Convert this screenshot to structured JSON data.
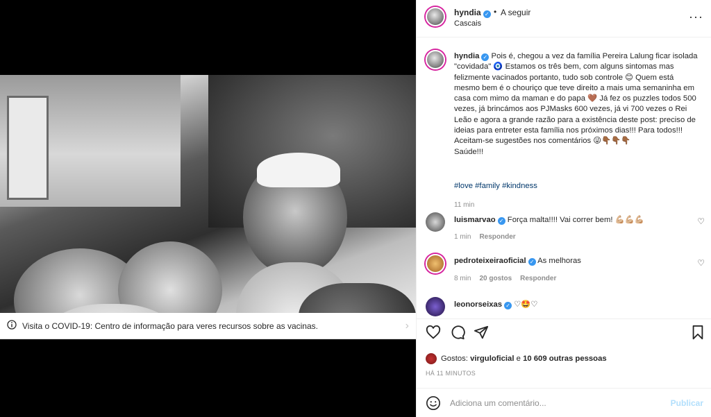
{
  "post": {
    "username": "hyndia",
    "follow_dot": "•",
    "follow_label": "A seguir",
    "location": "Cascais",
    "more_glyph": "···"
  },
  "banner": {
    "text": "Visita o COVID-19: Centro de informação para veres recursos sobre as vacinas."
  },
  "caption": {
    "username": "hyndia",
    "text": "Pois é, chegou a vez da família Pereira Lalung ficar isolada \"covidada\" 🧿 Estamos os três bem, com alguns sintomas mas felizmente vacinados portanto, tudo sob controle 😊 Quem está mesmo bem é o chouriço que teve direito a mais uma semaninha em casa com mimo da maman e do papa 🤎 Já fez os puzzles todos 500 vezes, já brincámos aos PJMasks 600 vezes, já vi 700 vezes o Rei Leão e agora a grande razão para a existência deste post: preciso de ideias para entreter esta família nos próximos dias!!! Para todos!!! Aceitam-se sugestões nos comentários 😜👇🏾👇🏾👇🏾",
    "sign_off": "Saúde!!!",
    "tags": "#love #family #kindness",
    "time": "11 min"
  },
  "comments": [
    {
      "username": "luismarvao",
      "text": "Força malta!!!! Vai correr bem! 💪🏼💪🏼💪🏼",
      "time": "1 min",
      "likes": "",
      "reply": "Responder"
    },
    {
      "username": "pedroteixeiraoficial",
      "text": "As melhoras",
      "time": "8 min",
      "likes": "20 gostos",
      "reply": "Responder"
    },
    {
      "username": "leonorseixas",
      "text": "♡🤩♡",
      "time": "",
      "likes": "",
      "reply": ""
    }
  ],
  "likes": {
    "prefix": "Gostos:",
    "first_user": "virguloficial",
    "middle": "e",
    "others": "10 609 outras pessoas"
  },
  "posted_ago": "HÁ 11 MINUTOS",
  "composer": {
    "placeholder": "Adiciona um comentário...",
    "publish_label": "Publicar"
  },
  "colors": {
    "verified": "#3897f0",
    "link": "#00376b",
    "publish_disabled": "#b2dffc",
    "muted": "#8e8e8e"
  },
  "icons": [
    "user-tag-icon",
    "info-icon",
    "chevron-right-icon",
    "verified-icon",
    "more-icon",
    "heart-icon",
    "comment-icon",
    "share-icon",
    "bookmark-icon",
    "smile-icon"
  ]
}
